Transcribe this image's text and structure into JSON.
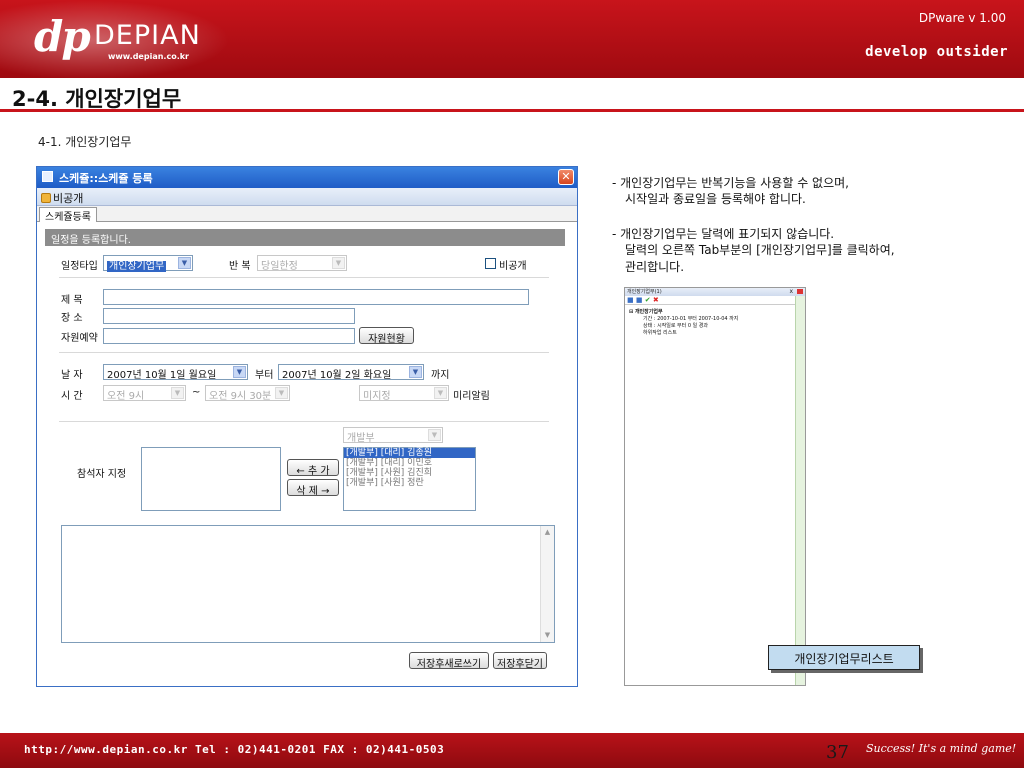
{
  "header": {
    "logo_mark": "dp",
    "logo_name": "DEPIAN",
    "logo_url": "www.depian.co.kr",
    "version": "DPware v 1.00",
    "tagline": "develop outsider"
  },
  "page_title": "2-4. 개인장기업무",
  "subsection_title": "4-1. 개인장기업무",
  "window": {
    "title": "스케쥴::스케쥴 등록",
    "close_label": "✕",
    "toolbar_button": "비공개",
    "tab_label": "스케쥴등록",
    "section_header": "일정을 등록합니다.",
    "schedule_type_label": "일정타입",
    "schedule_type_value": "개인장기업무",
    "repeat_label": "반 복",
    "repeat_value": "당일한정",
    "private_label": "비공개",
    "subject_label": "제 목",
    "place_label": "장 소",
    "resource_label": "자원예약",
    "resource_button": "자원현황",
    "date_label": "날 자",
    "date_start": "2007년 10월  1일 월요일",
    "from_label": "부터",
    "date_end": "2007년 10월  2일 화요일",
    "until_label": "까지",
    "time_label": "시 간",
    "time_start": "오전 9시",
    "tilde": "~",
    "time_end": "오전 9시 30분",
    "alarm_select": "미지정",
    "alarm_label": "미리알림",
    "dept_select": "개발부",
    "attendee_label": "참석자 지정",
    "add_button": "← 추 가",
    "remove_button": "삭 제 →",
    "members": [
      "[개발부] [대리] 김종원",
      "[개발부] [대리] 이민호",
      "[개발부] [사원] 김진희",
      "[개발부] [사원] 정란"
    ],
    "save_new_button": "저장후새로쓰기",
    "save_close_button": "저장후닫기"
  },
  "description": {
    "para1_line1": "- 개인장기업무는 반복기능을 사용할 수 없으며,",
    "para1_line2": "시작일과 종료일을 등록해야 합니다.",
    "para2_line1": "- 개인장기업무는 달력에 표기되지 않습니다.",
    "para2_line2": "달력의 오른쪽 Tab부분의 [개인장기업무]를 클릭하여,",
    "para2_line3": "관리합니다."
  },
  "mini_panel": {
    "title": "개인장기업무(1)",
    "close": "x",
    "tree_root": "개인장기업무",
    "period": "기간 : 2007-10-01 부터 2007-10-04 까지",
    "status": "상태 : 시작일로 부터 0 일 경과",
    "sub_list": "하위작업 리스트"
  },
  "callout_label": "개인장기업무리스트",
  "footer": {
    "info": "http://www.depian.co.kr   Tel : 02)441-0201   FAX : 02)441-0503",
    "page_number": "37",
    "slogan": "Success! It's a mind game!"
  },
  "colors": {
    "brand_red": "#c8141b",
    "window_blue": "#1f5cc6",
    "callout_blue": "#c2dcf0"
  }
}
